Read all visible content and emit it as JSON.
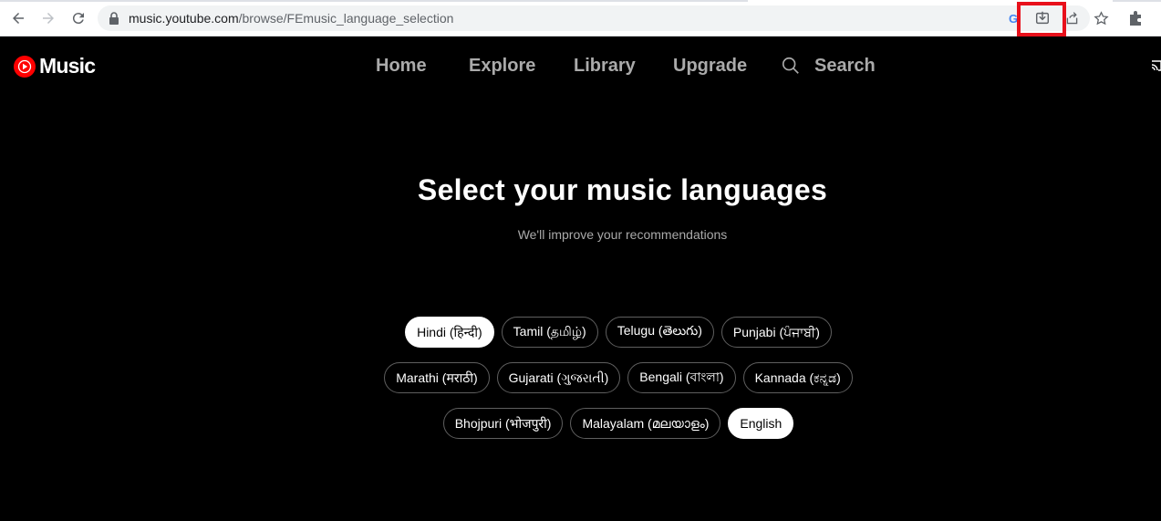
{
  "browser": {
    "url_domain": "music.youtube.com",
    "url_path": "/browse/FEmusic_language_selection",
    "highlight_color": "#e8101b"
  },
  "header": {
    "logo_text": "Music",
    "brand_color": "#ff0000",
    "nav": [
      "Home",
      "Explore",
      "Library",
      "Upgrade"
    ],
    "search_label": "Search"
  },
  "main": {
    "title": "Select your music languages",
    "subtitle": "We'll improve your recommendations",
    "languages": [
      [
        {
          "label": "Hindi (हिन्दी)",
          "selected": true
        },
        {
          "label": "Tamil (தமிழ்)",
          "selected": false
        },
        {
          "label": "Telugu (తెలుగు)",
          "selected": false
        },
        {
          "label": "Punjabi (ਪੰਜਾਬੀ)",
          "selected": false
        }
      ],
      [
        {
          "label": "Marathi (मराठी)",
          "selected": false
        },
        {
          "label": "Gujarati (ગુજરાતી)",
          "selected": false
        },
        {
          "label": "Bengali (বাংলা)",
          "selected": false
        },
        {
          "label": "Kannada (ಕನ್ನಡ)",
          "selected": false
        }
      ],
      [
        {
          "label": "Bhojpuri (भोजपुरी)",
          "selected": false
        },
        {
          "label": "Malayalam (മലയാളം)",
          "selected": false
        },
        {
          "label": "English",
          "selected": true
        }
      ]
    ]
  }
}
